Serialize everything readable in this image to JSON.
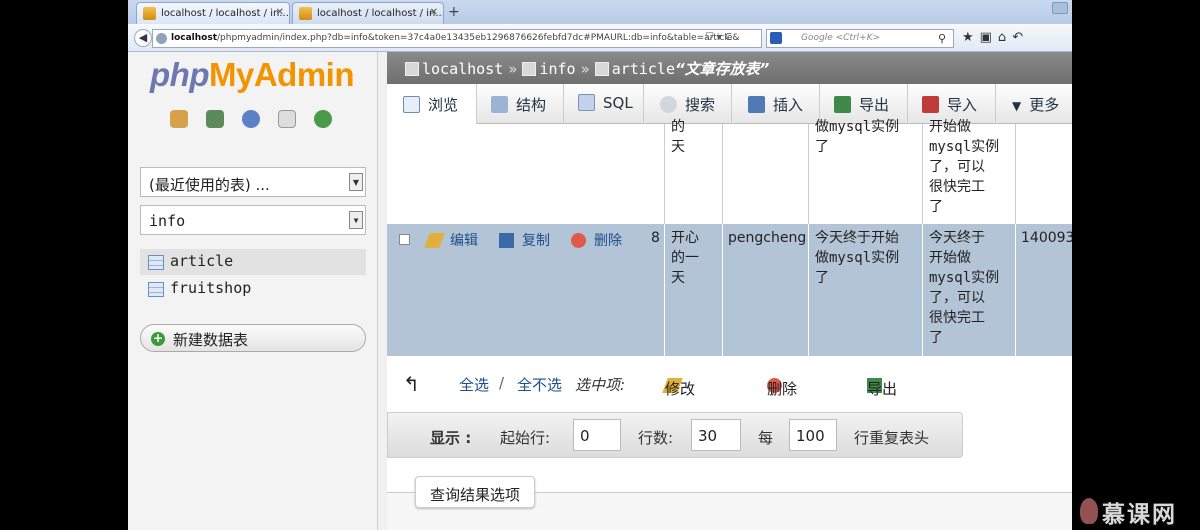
{
  "browser": {
    "tabs": [
      {
        "label": "localhost / localhost / in..."
      },
      {
        "label": "localhost / localhost / in..."
      }
    ],
    "new_tab": "+",
    "url_host": "localhost",
    "url_path": "/phpmyadmin/index.php?db=info&token=37c4a0e13435eb1296876626febfd7dc#PMAURL:db=info&table=article&",
    "search_placeholder": "Google <Ctrl+K>"
  },
  "left": {
    "logo_php": "php",
    "logo_myadmin": "MyAdmin",
    "recent_select": "(最近使用的表) ...",
    "db_select": "info",
    "tables": [
      "article",
      "fruitshop"
    ],
    "new_table": "新建数据表"
  },
  "breadcrumb": {
    "server": "localhost",
    "db": "info",
    "table": "article",
    "table_comment": "“文章存放表”",
    "sep": "»"
  },
  "tabs": [
    "浏览",
    "结构",
    "SQL",
    "搜索",
    "插入",
    "导出",
    "导入",
    "更多"
  ],
  "grid": {
    "prev_row": {
      "title_lines": [
        "的",
        "天"
      ],
      "content_lines": [
        "做mysql实例",
        "了"
      ],
      "summary_lines": [
        "开始做",
        "mysql实例",
        "了，可以",
        "很快完工",
        "了"
      ]
    },
    "row": {
      "actions": {
        "edit": "编辑",
        "copy": "复制",
        "delete": "删除"
      },
      "id": "8",
      "title_lines": [
        "开心",
        "的一",
        "天"
      ],
      "author": "pengcheng",
      "content_lines": [
        "今天终于开始",
        "做mysql实例",
        "了"
      ],
      "summary_lines": [
        "今天终于",
        "开始做",
        "mysql实例",
        "了，可以",
        "很快完工",
        "了"
      ],
      "time": "140093"
    }
  },
  "bulk": {
    "check_all": "全选",
    "slash": "/",
    "uncheck_all": "全不选",
    "with_selected": "选中项:",
    "edit": "修改",
    "delete": "删除",
    "export": "导出"
  },
  "display": {
    "label": "显示 :",
    "start_row_label": "起始行:",
    "start_row": "0",
    "rows_label": "行数:",
    "rows": "30",
    "every_label": "每",
    "every": "100",
    "repeat_header": "行重复表头"
  },
  "query_options": "查询结果选项",
  "watermark": "慕课网"
}
